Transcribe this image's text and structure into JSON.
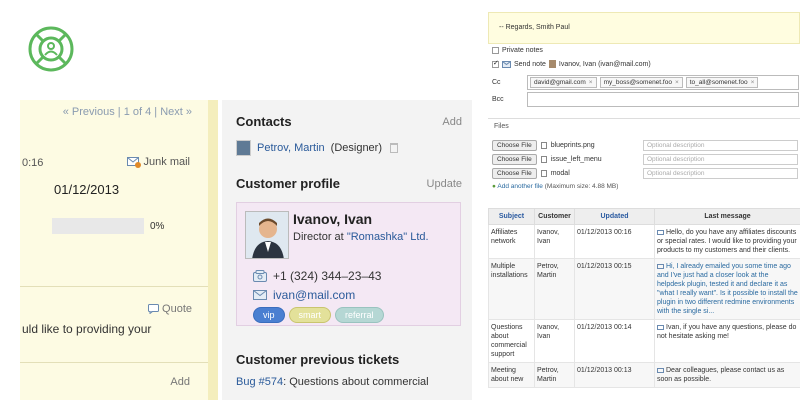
{
  "left": {
    "pagination": {
      "previous": "« Previous",
      "position": "1 of 4",
      "next": "Next »"
    },
    "time_fragment": "0:16",
    "junk_mail": "Junk mail",
    "date": "01/12/2013",
    "progress": {
      "value": 0,
      "label": "0%"
    },
    "quote": "Quote",
    "quote_text": "uld like to providing your",
    "add": "Add"
  },
  "middle": {
    "contacts_title": "Contacts",
    "contacts_add": "Add",
    "contact": {
      "name": "Petrov, Martin",
      "role": "(Designer)"
    },
    "profile_title": "Customer profile",
    "profile_update": "Update",
    "profile": {
      "name": "Ivanov, Ivan",
      "role_prefix": "Director at",
      "company": "\"Romashka\" Ltd.",
      "phone": "+1 (324) 344–23–43",
      "email": "ivan@mail.com",
      "tags": [
        "vip",
        "smart",
        "referral"
      ]
    },
    "prev_tickets_title": "Customer previous tickets",
    "prev_ticket": {
      "id": "Bug #574",
      "text": ": Questions about commercial"
    }
  },
  "right": {
    "regards": "-- Regards, Smith Paul",
    "private_notes": "Private notes",
    "send_note": "Send note",
    "send_note_to": "Ivanov, Ivan (ivan@mail.com)",
    "cc_label": "Cc",
    "bcc_label": "Bcc",
    "cc_chips": [
      "david@gmail.com",
      "my_boss@somenet.foo",
      "to_all@somenet.foo"
    ],
    "files_label": "Files",
    "choose_file": "Choose File",
    "files": [
      {
        "name": "blueprints.png",
        "placeholder": "Optional description"
      },
      {
        "name": "issue_left_menu",
        "placeholder": "Optional description"
      },
      {
        "name": "modal",
        "placeholder": "Optional description"
      }
    ],
    "add_another_file": "Add another file",
    "max_size": "(Maximum size: 4.88 MB)",
    "table": {
      "headers": [
        "Subject",
        "Customer",
        "Updated",
        "Last message"
      ],
      "rows": [
        {
          "subject": "Affiliates network",
          "customer": "Ivanov, Ivan",
          "updated": "01/12/2013 00:16",
          "message": "Hello, do you have any affiliates discounts or special rates. I would like to providing your products to my customers and their clients."
        },
        {
          "subject": "Multiple installations",
          "customer": "Petrov, Martin",
          "updated": "01/12/2013 00:15",
          "message": "Hi, I already emailed you some time ago and I've just had a closer look at the helpdesk plugin, tested it and declare it as \"what I really want\". Is it possible to install the plugin in two different redmine environments with the single si..."
        },
        {
          "subject": "Questions about commercial support",
          "customer": "Ivanov, Ivan",
          "updated": "01/12/2013 00:14",
          "message": "Ivan, if you have any questions, please do not hesitate asking me!"
        },
        {
          "subject": "Meeting about new",
          "customer": "Petrov, Martin",
          "updated": "01/12/2013 00:13",
          "message": "Dear colleagues, please contact us as soon as possible."
        }
      ]
    }
  },
  "colors": {
    "brand_green": "#5cb85c",
    "ticket_yellow": "#fdfbe3",
    "link_blue": "#2a5a9a"
  }
}
